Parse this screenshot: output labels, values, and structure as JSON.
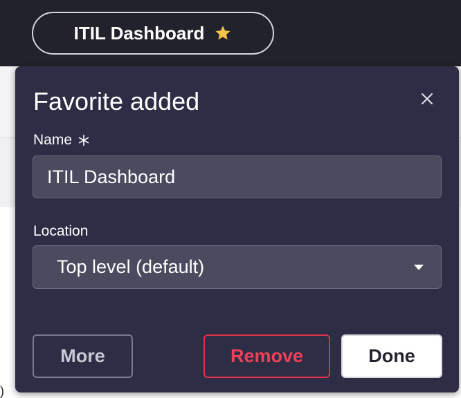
{
  "header": {
    "pill_label": "ITIL Dashboard",
    "star_icon": "star-icon",
    "star_color": "#f3c44a"
  },
  "popover": {
    "title": "Favorite added",
    "close_icon": "close-icon",
    "name_label": "Name",
    "required_icon": "asterisk-icon",
    "name_value": "ITIL Dashboard",
    "location_label": "Location",
    "location_value": "Top level (default)",
    "dropdown_icon": "caret-down-icon",
    "buttons": {
      "more": "More",
      "remove": "Remove",
      "done": "Done"
    }
  },
  "page": {
    "stray_text": ")"
  },
  "colors": {
    "topbar_bg": "#22222c",
    "popover_bg": "#2d2d45",
    "remove_accent": "#e0334b",
    "field_bg": "#4b4b5f"
  }
}
